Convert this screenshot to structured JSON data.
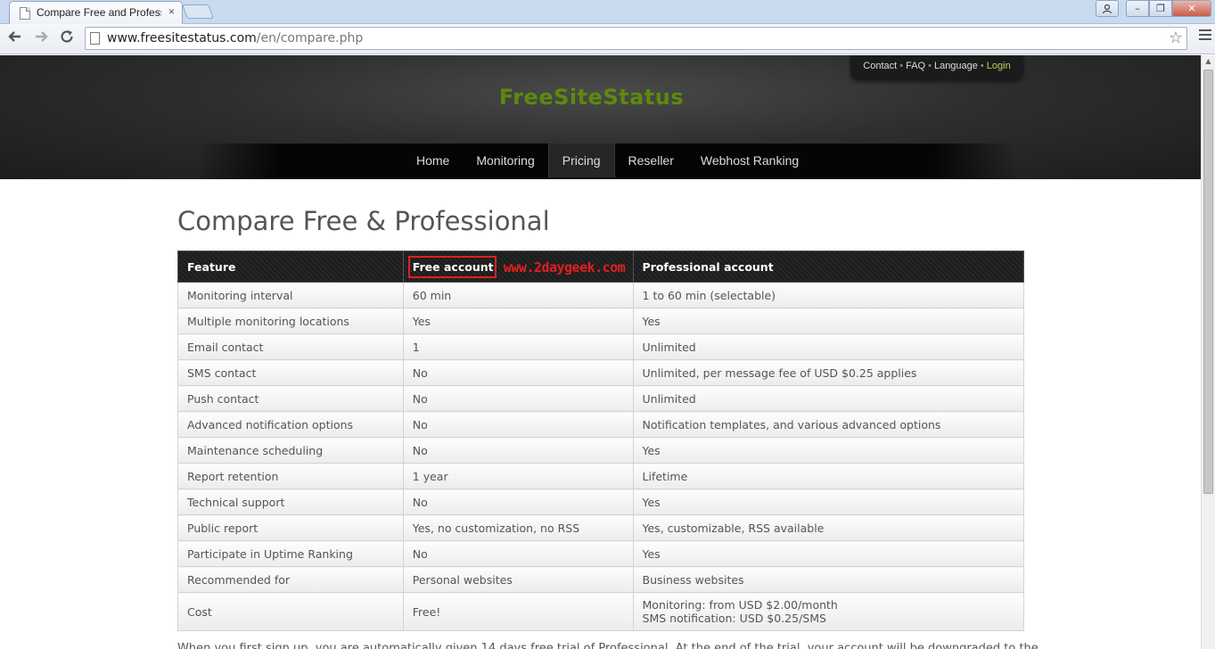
{
  "browser": {
    "tab_title": "Compare Free and Profess",
    "tab_close": "×",
    "url_host": "www.freesitestatus.com",
    "url_path": "/en/compare.php",
    "window_buttons": {
      "user": "user-icon",
      "minimize": "–",
      "maximize": "❐",
      "close": "✕"
    }
  },
  "header": {
    "toplinks": {
      "contact": "Contact",
      "faq": "FAQ",
      "language": "Language",
      "login": "Login",
      "separator": "•"
    },
    "logo": "FreeSiteStatus",
    "nav": [
      "Home",
      "Monitoring",
      "Pricing",
      "Reseller",
      "Webhost Ranking"
    ],
    "active_nav": "Pricing"
  },
  "main": {
    "title": "Compare Free & Professional",
    "table": {
      "headers": [
        "Feature",
        "Free account",
        "Professional account"
      ],
      "rows": [
        [
          "Monitoring interval",
          "60 min",
          "1 to 60 min (selectable)"
        ],
        [
          "Multiple monitoring locations",
          "Yes",
          "Yes"
        ],
        [
          "Email contact",
          "1",
          "Unlimited"
        ],
        [
          "SMS contact",
          "No",
          "Unlimited, per message fee of USD $0.25 applies"
        ],
        [
          "Push contact",
          "No",
          "Unlimited"
        ],
        [
          "Advanced notification options",
          "No",
          "Notification templates, and various advanced options"
        ],
        [
          "Maintenance scheduling",
          "No",
          "Yes"
        ],
        [
          "Report retention",
          "1 year",
          "Lifetime"
        ],
        [
          "Technical support",
          "No",
          "Yes"
        ],
        [
          "Public report",
          "Yes, no customization, no RSS",
          "Yes, customizable, RSS available"
        ],
        [
          "Participate in Uptime Ranking",
          "No",
          "Yes"
        ],
        [
          "Recommended for",
          "Personal websites",
          "Business websites"
        ]
      ],
      "cost_row": {
        "feature": "Cost",
        "free": "Free!",
        "pro_line1": "Monitoring: from USD $2.00/month",
        "pro_line2": "SMS notification: USD $0.25/SMS"
      }
    },
    "watermark": "www.2daygeek.com",
    "bottom_text": "When you first sign up, you are automatically given 14 days free trial of Professional. At the end of the trial, your account will be downgraded to the"
  },
  "colors": {
    "logo": "#5c8a0c",
    "login": "#b6d45a",
    "highlight": "#e02020"
  }
}
